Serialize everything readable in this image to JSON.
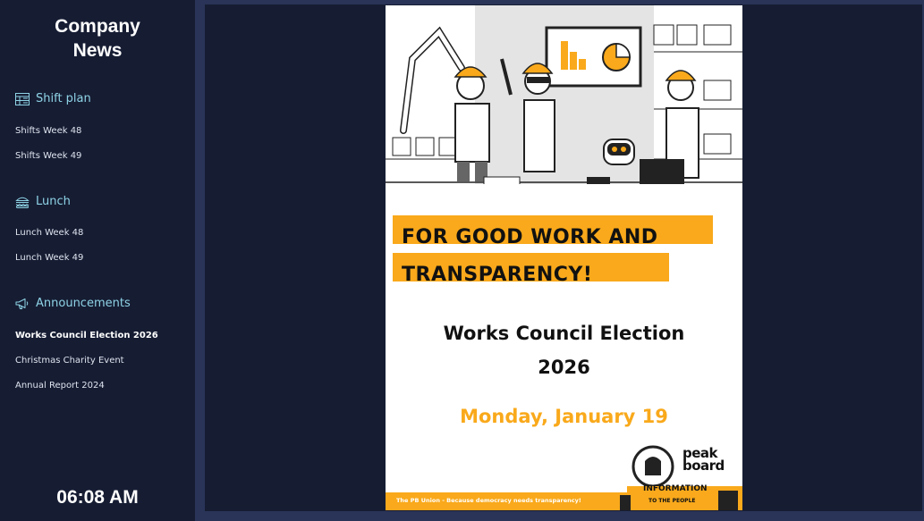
{
  "sidebar": {
    "title_line1": "Company",
    "title_line2": "News",
    "sections": [
      {
        "label": "Shift plan",
        "icon": "calendar-grid-icon",
        "items": [
          "Shifts Week 48",
          "Shifts Week 49"
        ]
      },
      {
        "label": "Lunch",
        "icon": "burger-icon",
        "items": [
          "Lunch Week 48",
          "Lunch Week 49"
        ]
      },
      {
        "label": "Announcements",
        "icon": "megaphone-icon",
        "items": [
          "Works Council Election 2026",
          "Christmas Charity Event",
          "Annual Report 2024"
        ]
      }
    ],
    "active_item": "Works Council Election 2026",
    "clock": "06:08 AM"
  },
  "poster": {
    "headline_line1": "FOR GOOD WORK AND",
    "headline_line2": "TRANSPARENCY!",
    "event_title_line1": "Works Council Election",
    "event_title_line2": "2026",
    "event_date": "Monday, January 19",
    "footer": "The PB Union - Because democracy needs transparency!",
    "brand_line1": "peak",
    "brand_line2": "board",
    "info_text": "INFORMATION",
    "info_sub": "TO THE PEOPLE",
    "accent_color": "#f9a91b"
  },
  "colors": {
    "background": "#161d33",
    "frame": "#2a3458",
    "section_heading": "#8fd3e6"
  }
}
